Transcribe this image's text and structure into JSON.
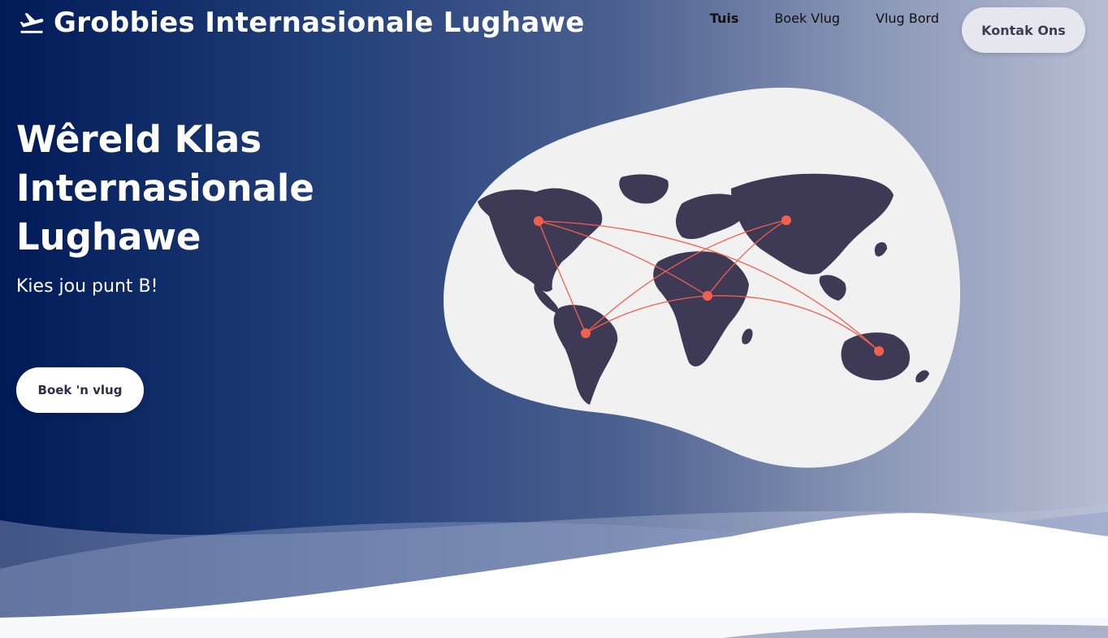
{
  "brand": {
    "title": "Grobbies Internasionale Lughawe",
    "icon": "airplane-departure-icon"
  },
  "nav": {
    "links": [
      "Tuis",
      "Boek Vlug",
      "Vlug Bord"
    ],
    "active": "Tuis",
    "contact_label": "Kontak Ons"
  },
  "hero": {
    "headline": "Wêreld Klas Internasionale Lughawe",
    "subline": "Kies jou punt B!",
    "cta_label": "Boek 'n vlug"
  },
  "colors": {
    "navy": "#001a57",
    "map_land": "#3e3a55",
    "route": "#f0604d",
    "blob": "#f1f1f2"
  }
}
